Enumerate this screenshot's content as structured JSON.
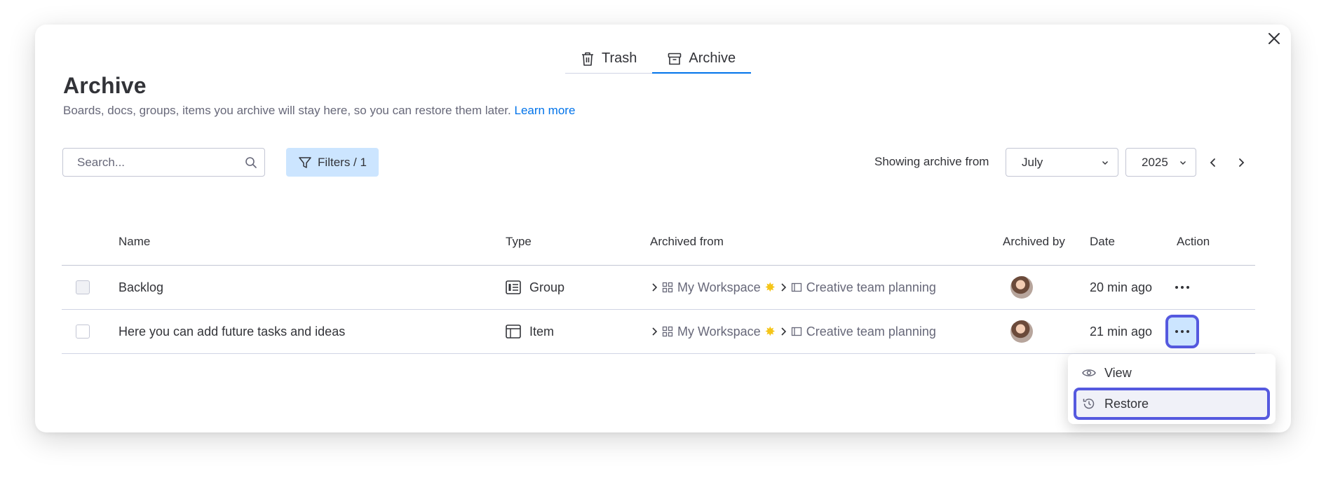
{
  "tabs": [
    {
      "label": "Trash",
      "icon": "trash-icon"
    },
    {
      "label": "Archive",
      "icon": "archive-icon",
      "active": true
    }
  ],
  "page": {
    "title": "Archive",
    "subtitle": "Boards, docs, groups, items you archive will stay here, so you can restore them later.",
    "learn_more": "Learn more"
  },
  "toolbar": {
    "search_placeholder": "Search...",
    "filters_label": "Filters / 1",
    "showing_label": "Showing archive from",
    "month": "July",
    "year": "2025"
  },
  "table": {
    "columns": [
      "Name",
      "Type",
      "Archived from",
      "Archived by",
      "Date",
      "Action"
    ],
    "rows": [
      {
        "name": "Backlog",
        "type": "Group",
        "workspace": "My Workspace",
        "board": "Creative team planning",
        "date": "20 min ago"
      },
      {
        "name": "Here you can add future tasks and ideas",
        "type": "Item",
        "workspace": "My Workspace",
        "board": "Creative team planning",
        "date": "21 min ago"
      }
    ]
  },
  "menu": {
    "items": [
      {
        "label": "View",
        "icon": "eye-icon"
      },
      {
        "label": "Restore",
        "icon": "history-icon"
      }
    ]
  },
  "colors": {
    "accent": "#0073ea",
    "focus_ring": "#5559df",
    "filter_bg": "#cce5ff",
    "text": "#323338",
    "muted": "#676879"
  }
}
